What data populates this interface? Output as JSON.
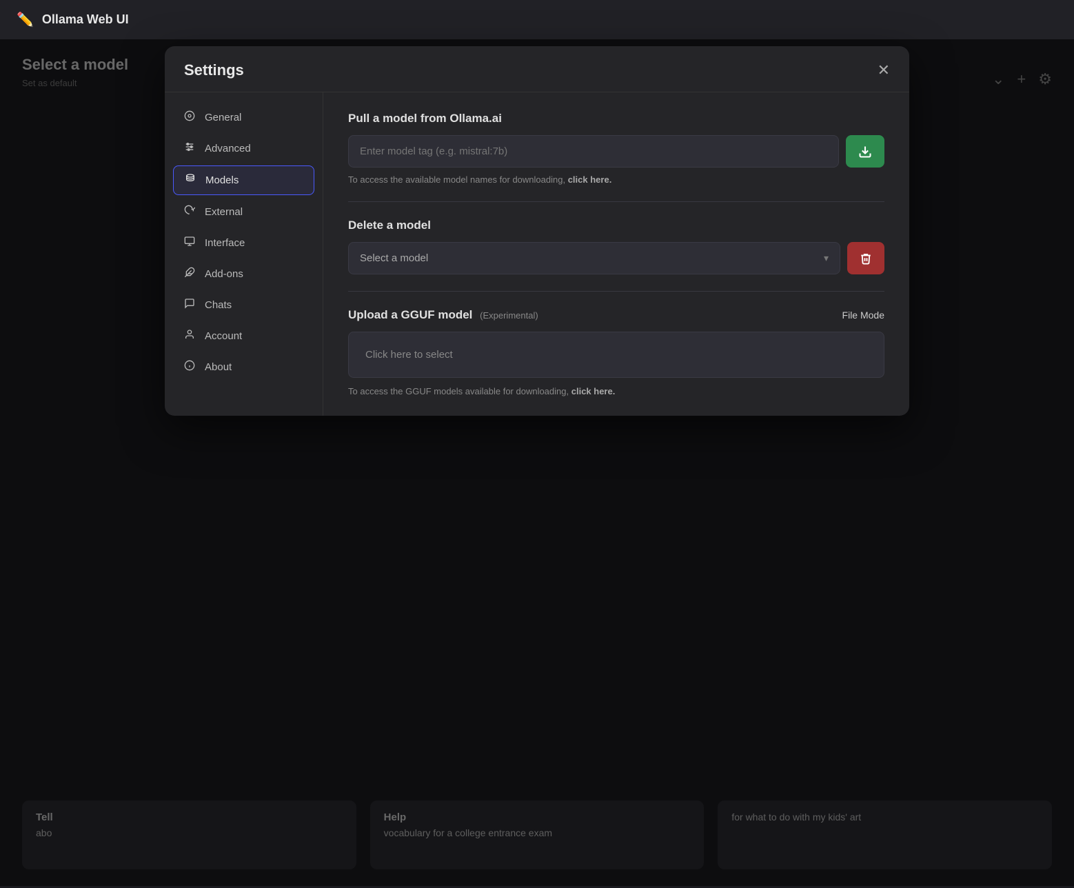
{
  "app": {
    "title": "Ollama Web UI"
  },
  "header": {
    "model_select_label": "Select a model",
    "set_default": "Set as default"
  },
  "topbar_icons": {
    "chevron": "⌄",
    "plus": "+",
    "gear": "⚙"
  },
  "modal": {
    "title": "Settings",
    "close_icon": "✕"
  },
  "sidebar": {
    "items": [
      {
        "id": "general",
        "label": "General",
        "icon": "⚙"
      },
      {
        "id": "advanced",
        "label": "Advanced",
        "icon": "⚡"
      },
      {
        "id": "models",
        "label": "Models",
        "icon": "🗄",
        "active": true
      },
      {
        "id": "external",
        "label": "External",
        "icon": "☁"
      },
      {
        "id": "interface",
        "label": "Interface",
        "icon": "🖼"
      },
      {
        "id": "addons",
        "label": "Add-ons",
        "icon": "🧩"
      },
      {
        "id": "chats",
        "label": "Chats",
        "icon": "💬"
      },
      {
        "id": "account",
        "label": "Account",
        "icon": "👤"
      },
      {
        "id": "about",
        "label": "About",
        "icon": "ℹ"
      }
    ]
  },
  "settings_models": {
    "pull_section_title": "Pull a model from Ollama.ai",
    "pull_input_placeholder": "Enter model tag (e.g. mistral:7b)",
    "pull_help_text": "To access the available model names for downloading,",
    "pull_help_link": "click here.",
    "delete_section_title": "Delete a model",
    "delete_select_placeholder": "Select a model",
    "upload_section_title": "Upload a GGUF model",
    "upload_experimental": "(Experimental)",
    "file_mode_label": "File Mode",
    "upload_zone_text": "Click here to select",
    "upload_help_text": "To access the GGUF models available for downloading,",
    "upload_help_link": "click here."
  },
  "chat_cards": [
    {
      "title": "Tell",
      "body": "abo"
    },
    {
      "title": "Help",
      "body": "vocabulary for a college entrance exam"
    },
    {
      "title": "",
      "body": "for what to do with my kids' art"
    }
  ]
}
